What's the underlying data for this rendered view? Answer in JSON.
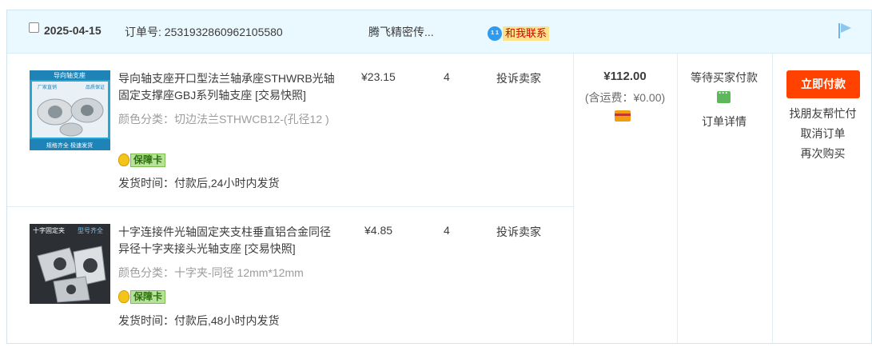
{
  "header": {
    "date": "2025-04-15",
    "order_no_label": "订单号: 2531932860962105580",
    "shop_name": "腾飞精密传...",
    "contact_label": "和我联系",
    "contact_bubble": "1 1"
  },
  "items": [
    {
      "title": "导向轴支座开口型法兰轴承座STHWRB光轴固定支撑座GBJ系列轴支座 [交易快照]",
      "spec": "颜色分类：切边法兰STHWCB12-(孔径12 )",
      "badge": "保障卡",
      "ship": "发货时间：付款后,24小时内发货",
      "price": "¥23.15",
      "qty": "4",
      "complain": "投诉卖家"
    },
    {
      "title": "十字连接件光轴固定夹支柱垂直铝合金同径异径十字夹接头光轴支座 [交易快照]",
      "spec": "颜色分类：十字夹-同径 12mm*12mm",
      "badge": "保障卡",
      "ship": "发货时间：付款后,48小时内发货",
      "price": "¥4.85",
      "qty": "4",
      "complain": "投诉卖家"
    }
  ],
  "thumb1": {
    "top_label": "导向轴支座",
    "left_label": "厂家直销",
    "right_label": "品质保证",
    "bottom_label": "规格齐全 极速发货"
  },
  "thumb2": {
    "tl_label": "十字固定夹",
    "tr_label": "型号齐全"
  },
  "summary": {
    "total": "¥112.00",
    "shipping": "(含运费：¥0.00)"
  },
  "status": {
    "text": "等待买家付款",
    "detail": "订单详情"
  },
  "actions": {
    "pay": "立即付款",
    "friend_pay": "找朋友帮忙付",
    "cancel": "取消订单",
    "rebuy": "再次购买"
  },
  "colors": {
    "header_bg": "#eaf8ff",
    "pay_button": "#ff4200",
    "border": "#cfe4ee"
  }
}
